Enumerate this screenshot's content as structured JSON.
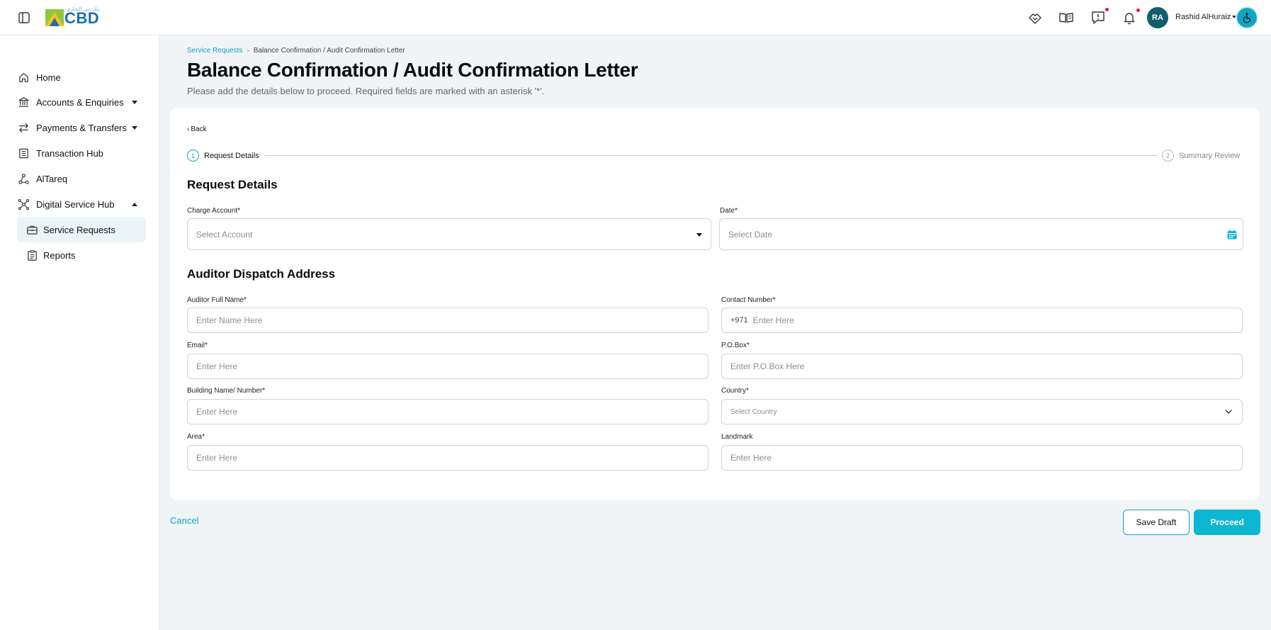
{
  "topbar": {
    "logo_text": "CBD",
    "logo_arabic": "بنك دبي التجاري",
    "user_initials": "RA",
    "user_name": "Rashid AlHuraiz"
  },
  "sidebar": {
    "items": [
      {
        "label": "Home",
        "icon": "home-icon"
      },
      {
        "label": "Accounts & Enquiries",
        "icon": "bank-icon"
      },
      {
        "label": "Payments & Transfers",
        "icon": "transfer-icon"
      },
      {
        "label": "Transaction Hub",
        "icon": "list-icon"
      },
      {
        "label": "AlTareq",
        "icon": "network-icon"
      },
      {
        "label": "Digital Service Hub",
        "icon": "hub-icon"
      }
    ],
    "subitems": [
      {
        "label": "Service Requests",
        "icon": "briefcase-icon"
      },
      {
        "label": "Reports",
        "icon": "clipboard-icon"
      }
    ]
  },
  "breadcrumb": {
    "parent": "Service Requests",
    "current": "Balance Confirmation / Audit Confirmation Letter"
  },
  "page": {
    "title": "Balance Confirmation / Audit Confirmation Letter",
    "subtitle": "Please add the details below to proceed. Required fields are marked with an asterisk '*'."
  },
  "card": {
    "back_label": "Back",
    "steps": [
      {
        "number": "1",
        "label": "Request Details"
      },
      {
        "number": "2",
        "label": "Summary Review"
      }
    ],
    "section1_title": "Request Details",
    "section2_title": "Auditor Dispatch Address",
    "fields": {
      "charge_account": {
        "label": "Charge Account*",
        "placeholder": "Select Account"
      },
      "date": {
        "label": "Date*",
        "placeholder": "Select Date"
      },
      "auditor_name": {
        "label": "Auditor Full Name*",
        "placeholder": "Enter Name Here"
      },
      "contact_number": {
        "label": "Contact Number*",
        "prefix": "+971",
        "placeholder": "Enter Here"
      },
      "email": {
        "label": "Email*",
        "placeholder": "Enter Here"
      },
      "po_box": {
        "label": "P.O.Box*",
        "placeholder": "Enter P.O.Box Here"
      },
      "building": {
        "label": "Building Name/ Number*",
        "placeholder": "Enter Here"
      },
      "country": {
        "label": "Country*",
        "placeholder": "Select Country"
      },
      "area": {
        "label": "Area*",
        "placeholder": "Enter Here"
      },
      "landmark": {
        "label": "Landmark",
        "placeholder": "Enter Here"
      }
    }
  },
  "actions": {
    "cancel": "Cancel",
    "save_draft": "Save Draft",
    "proceed": "Proceed"
  },
  "colors": {
    "accent": "#12a5bf",
    "primary_button": "#0cb7d2",
    "avatar": "#0f5e6b",
    "notification_dot": "#d6213d"
  }
}
